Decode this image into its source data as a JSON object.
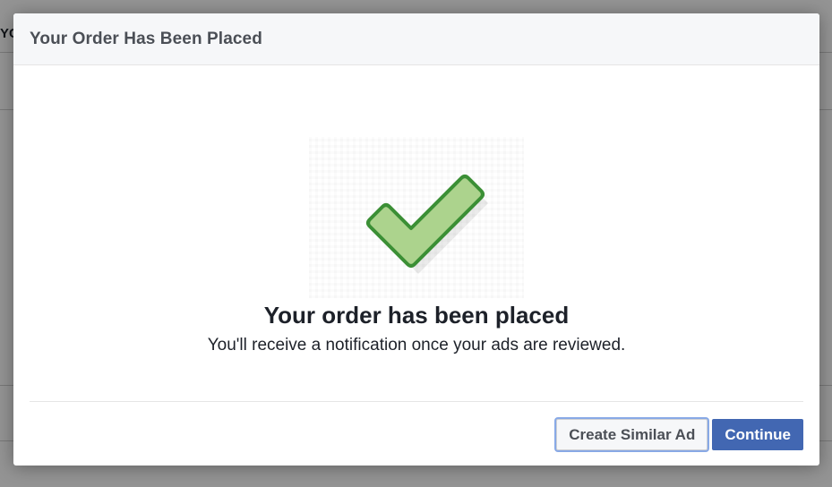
{
  "background": {
    "partial_text": "YC"
  },
  "dialog": {
    "title": "Your Order Has Been Placed",
    "heading": "Your order has been placed",
    "subtext": "You'll receive a notification once your ads are reviewed.",
    "icon": "checkmark-icon",
    "buttons": {
      "secondary_label": "Create Similar Ad",
      "primary_label": "Continue"
    }
  },
  "colors": {
    "primary": "#4267b2",
    "check_fill": "#acd38d",
    "check_stroke": "#3b8f35"
  }
}
